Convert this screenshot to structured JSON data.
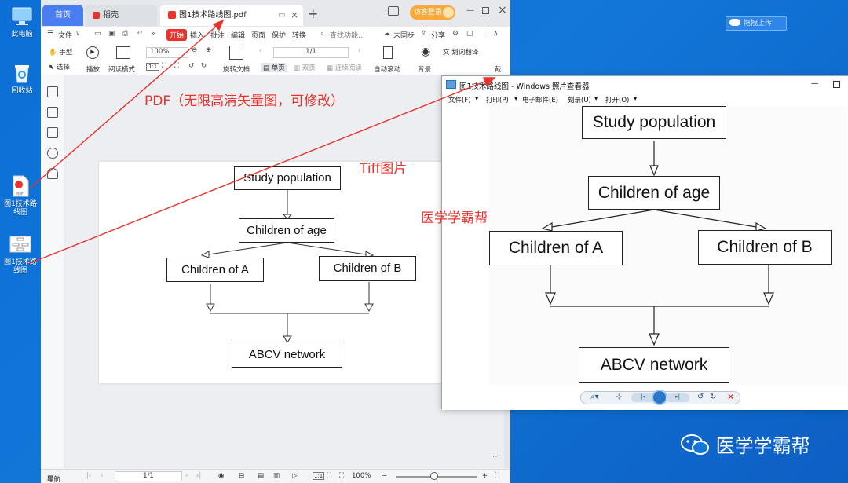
{
  "desktop": {
    "icons": [
      {
        "label": "此电脑"
      },
      {
        "label": "回收站"
      },
      {
        "label": "图1技术路线图"
      },
      {
        "label": "图1技术路线图"
      }
    ],
    "upload_button": "拖拽上传",
    "watermark": "医学学霸帮"
  },
  "wps": {
    "tabs": {
      "home": "首页",
      "daoke": "稻壳",
      "pdf": "图1技术路线图.pdf"
    },
    "guest_login": "访客登录",
    "menu": {
      "file": "文件",
      "start": "开始",
      "insert": "插入",
      "annotate": "批注",
      "edit": "编辑",
      "page": "页面",
      "protect": "保护",
      "convert": "转换",
      "search_placeholder": "查找功能...",
      "sync": "未同步",
      "share": "分享"
    },
    "tools": {
      "hand": "手型",
      "select": "选择",
      "play": "播放",
      "read_mode": "阅读模式",
      "zoom": "100%",
      "page_nav": "1/1",
      "rotate": "旋转文档",
      "single": "单页",
      "double": "双页",
      "continuous": "连续阅读",
      "auto_scroll": "自动滚动",
      "background": "背景",
      "translate": "划词翻译",
      "clip": "截"
    },
    "status": {
      "nav": "导航",
      "page": "1/1",
      "zoom": "100%"
    }
  },
  "diagram": {
    "top": "Study population",
    "mid": "Children of age",
    "left": "Children of A",
    "right": "Children of B",
    "bottom": "ABCV network"
  },
  "annotations": {
    "pdf_label": "PDF（无限高清矢量图，可修改）",
    "tiff_label": "Tiff图片",
    "brand_label": "医学学霸帮"
  },
  "viewer": {
    "title": "图1技术路线图 - Windows 照片查看器",
    "menu": {
      "file": "文件(F)",
      "print": "打印(P)",
      "email": "电子邮件(E)",
      "burn": "刻录(U)",
      "open": "打开(O)"
    }
  },
  "colors": {
    "accent": "#4a7ef0",
    "annotation": "#e8322c",
    "desktop": "#1277d9"
  }
}
